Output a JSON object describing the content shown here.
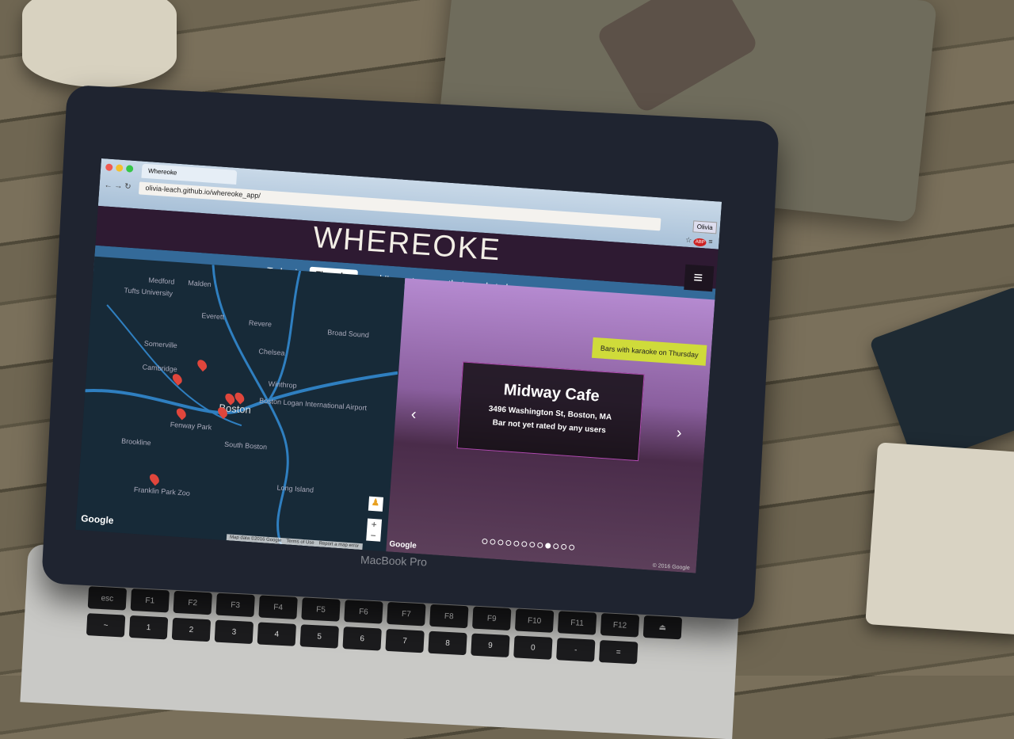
{
  "browser": {
    "tab_title": "Whereoke",
    "url": "olivia-leach.github.io/whereoke_app/",
    "profile": "Olivia",
    "extension_label": "ABP"
  },
  "app": {
    "logo": "WHEREOKE",
    "menu_icon": "hamburger-icon",
    "tagline": {
      "prefix": "Today is",
      "day": "Thursday",
      "suffix": "and I've got a song that needs to be sung."
    }
  },
  "map": {
    "labels": [
      "Medford",
      "Malden",
      "Tufts University",
      "Everett",
      "Revere",
      "Somerville",
      "Chelsea",
      "Cambridge",
      "Winthrop",
      "Boston",
      "Boston Logan International Airport",
      "Fenway Park",
      "Brookline",
      "South Boston",
      "Long Island",
      "Franklin Park Zoo",
      "Broad Sound"
    ],
    "brand": "Google",
    "zoom_in": "+",
    "zoom_out": "−",
    "attribution": [
      "Map data ©2016 Google",
      "Terms of Use",
      "Report a map error"
    ]
  },
  "streetview": {
    "badge": "Bars with karaoke on Thursday",
    "bar_name": "Midway Cafe",
    "address": "3496 Washington St, Boston, MA",
    "rating": "Bar not yet rated by any users",
    "prev": "‹",
    "next": "›",
    "slide_count": 12,
    "active_slide": 9,
    "brand": "Google",
    "copyright": "© 2016 Google"
  },
  "device": {
    "brand": "MacBook Pro",
    "keys": [
      "esc",
      "F1",
      "F2",
      "F3",
      "F4",
      "F5",
      "F6",
      "F7",
      "F8",
      "F9",
      "F10",
      "F11",
      "F12",
      "⏏",
      "~",
      "1",
      "2",
      "3",
      "4",
      "5",
      "6",
      "7",
      "8",
      "9",
      "0",
      "-",
      "="
    ]
  }
}
